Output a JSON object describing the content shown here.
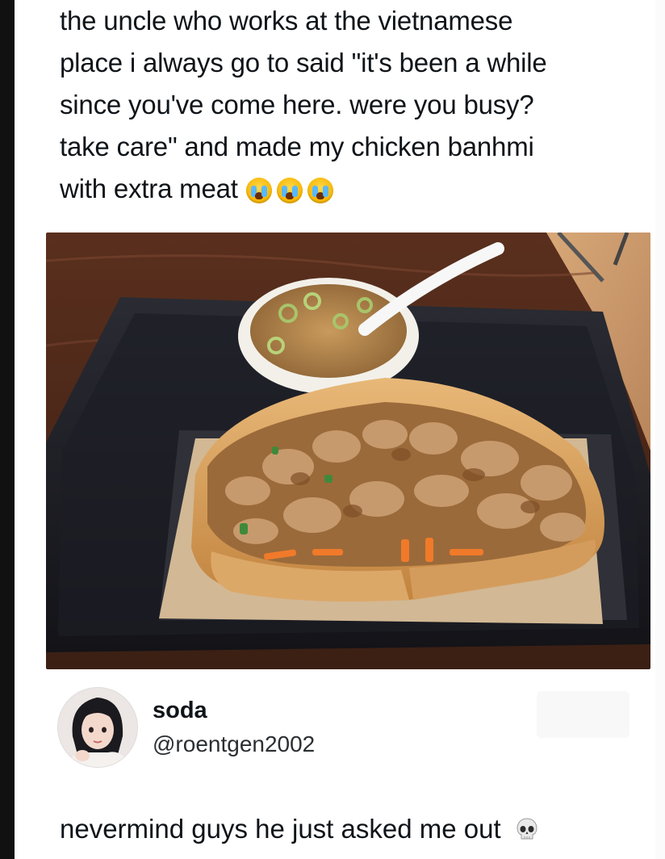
{
  "post": {
    "lines": [
      "the uncle who works at the vietnamese",
      "place i always go to said \"it's been a while",
      "since you've come here. were you busy?",
      "take care\" and made my chicken banhmi",
      "with extra meat"
    ],
    "trailing_emoji": [
      "loudly-crying-face",
      "loudly-crying-face",
      "loudly-crying-face"
    ]
  },
  "author": {
    "name": "soda",
    "handle": "@roentgen2002"
  },
  "reply": {
    "text": "nevermind guys he just asked me out",
    "emoji": "skull"
  },
  "colors": {
    "text": "#0f1419",
    "handle": "#2a2f33",
    "tray": "#1b1c22",
    "table": "#6b3a24",
    "bread": "#d9a05c",
    "carrot": "#f07a2a"
  }
}
